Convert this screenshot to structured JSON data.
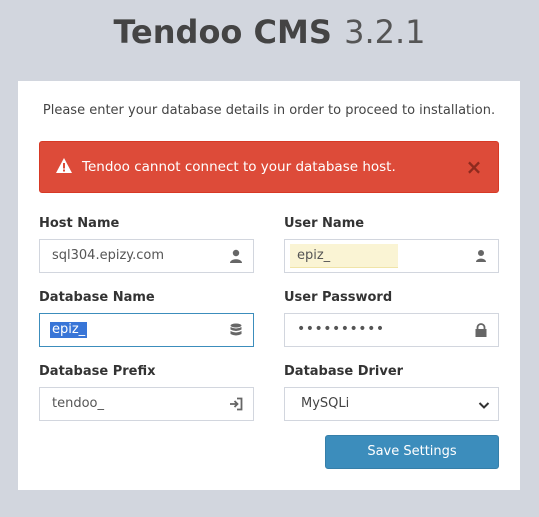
{
  "header": {
    "app_name": "Tendoo CMS",
    "version": "3.2.1"
  },
  "intro_text": "Please enter your database details in order to proceed to installation.",
  "alert": {
    "message": "Tendoo cannot connect to your database host.",
    "close_label": "×",
    "color": "#dd4b39"
  },
  "form": {
    "host_name": {
      "label": "Host Name",
      "value": "sql304.epizy.com",
      "icon": "user-icon"
    },
    "user_name": {
      "label": "User Name",
      "value": "epiz_",
      "icon": "user-icon"
    },
    "database_name": {
      "label": "Database Name",
      "value": "epiz_",
      "icon": "database-icon"
    },
    "user_password": {
      "label": "User Password",
      "value": "••••••••••",
      "icon": "lock-icon"
    },
    "database_prefix": {
      "label": "Database Prefix",
      "value": "tendoo_",
      "icon": "sign-in-icon"
    },
    "database_driver": {
      "label": "Database Driver",
      "value": "MySQLi"
    }
  },
  "save_button": {
    "label": "Save Settings",
    "color": "#3c8dbc"
  }
}
